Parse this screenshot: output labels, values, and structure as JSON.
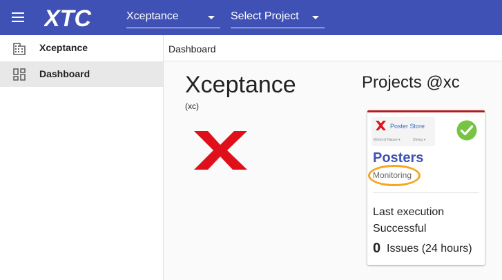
{
  "header": {
    "logo_text": "XTC",
    "org_select": {
      "value": "Xceptance"
    },
    "project_select": {
      "value": "Select Project"
    }
  },
  "sidebar": {
    "items": [
      {
        "label": "Xceptance",
        "icon": "building-icon",
        "active": false
      },
      {
        "label": "Dashboard",
        "icon": "dashboard-icon",
        "active": true
      }
    ]
  },
  "breadcrumb": {
    "current": "Dashboard"
  },
  "organization": {
    "name": "Xceptance",
    "short": "(xc)"
  },
  "projects": {
    "heading": "Projects @xc",
    "cards": [
      {
        "thumbnail": {
          "brand": "Poster Store",
          "nav_left": "World of Nature ▾",
          "nav_right": "Dining ▾"
        },
        "name": "Posters",
        "type": "Monitoring",
        "status_icon": "check-circle-icon",
        "last_execution_label": "Last execution",
        "last_execution_result": "Successful",
        "issues_count": "0",
        "issues_label": "Issues (24 hours)"
      }
    ]
  },
  "colors": {
    "topbar": "#3f51b5",
    "accent_red": "#e0101a",
    "success_green": "#77c442",
    "monitoring_highlight": "#f5a623"
  }
}
